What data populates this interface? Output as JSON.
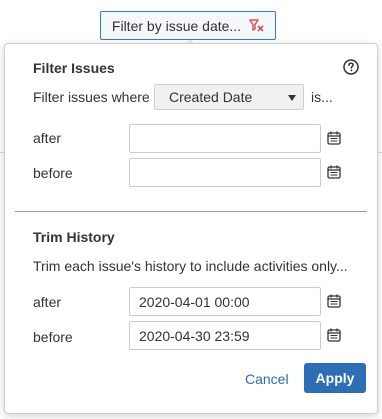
{
  "toolbar": {
    "filter_button_label": "Filter by issue date..."
  },
  "icons": {
    "clear_filter": "clear-filter-icon",
    "help": "question-circle-icon",
    "calendar": "calendar-icon"
  },
  "filter_issues": {
    "title": "Filter Issues",
    "prefix_text": "Filter issues where",
    "date_field": {
      "selected": "Created Date"
    },
    "suffix_text": "is...",
    "after": {
      "label": "after",
      "value": ""
    },
    "before": {
      "label": "before",
      "value": ""
    }
  },
  "trim_history": {
    "title": "Trim History",
    "description": "Trim each issue's history to include activities only...",
    "after": {
      "label": "after",
      "value": "2020-04-01 00:00"
    },
    "before": {
      "label": "before",
      "value": "2020-04-30 23:59"
    }
  },
  "actions": {
    "cancel_label": "Cancel",
    "apply_label": "Apply"
  },
  "colors": {
    "primary": "#2d6fb5",
    "link": "#2b6cb3",
    "clear_icon": "#d9534f",
    "text": "#333333"
  }
}
